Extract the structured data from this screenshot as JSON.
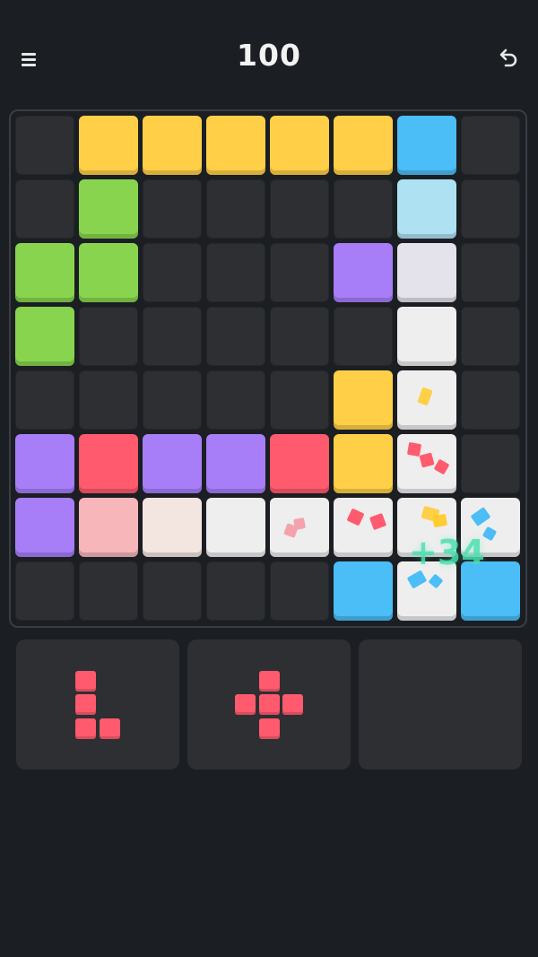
{
  "header": {
    "score": "100",
    "menu_icon": "hamburger-icon",
    "undo_icon": "undo-icon"
  },
  "colors": {
    "empty": "#2d2f33",
    "yellow": "#ffd047",
    "blue": "#4bbdf7",
    "lightblue": "#aee1f2",
    "green": "#88d44e",
    "purple": "#a77ef8",
    "red": "#ff5a6e",
    "pink": "#f6b6ba",
    "cream": "#f3e5e0",
    "white": "#eeeeee",
    "lavender": "#e4e2ea",
    "accent": "#49e0b0"
  },
  "board": {
    "size": 8,
    "rows": [
      [
        "empty",
        "yellow",
        "yellow",
        "yellow",
        "yellow",
        "yellow",
        "blue",
        "empty"
      ],
      [
        "empty",
        "green",
        "empty",
        "empty",
        "empty",
        "empty",
        "lightblue",
        "empty"
      ],
      [
        "green",
        "green",
        "empty",
        "empty",
        "empty",
        "purple",
        "lavender",
        "empty"
      ],
      [
        "green",
        "empty",
        "empty",
        "empty",
        "empty",
        "empty",
        "white",
        "empty"
      ],
      [
        "empty",
        "empty",
        "empty",
        "empty",
        "empty",
        "yellow",
        "white",
        "empty"
      ],
      [
        "purple",
        "red",
        "purple",
        "purple",
        "red",
        "yellow",
        "white",
        "empty"
      ],
      [
        "purple",
        "pink",
        "cream",
        "white",
        "white",
        "white",
        "white",
        "white"
      ],
      [
        "empty",
        "empty",
        "empty",
        "empty",
        "empty",
        "blue",
        "white",
        "blue"
      ]
    ]
  },
  "bonus_popup": "+34",
  "tray": [
    {
      "color": "#ff5a6e",
      "cells": [
        [
          0,
          0
        ],
        [
          1,
          0
        ],
        [
          2,
          0
        ],
        [
          2,
          1
        ]
      ]
    },
    {
      "color": "#ff5a6e",
      "cells": [
        [
          0,
          1
        ],
        [
          1,
          0
        ],
        [
          1,
          1
        ],
        [
          1,
          2
        ],
        [
          2,
          1
        ]
      ]
    },
    {
      "color": "#ff5a6e",
      "cells": []
    }
  ]
}
